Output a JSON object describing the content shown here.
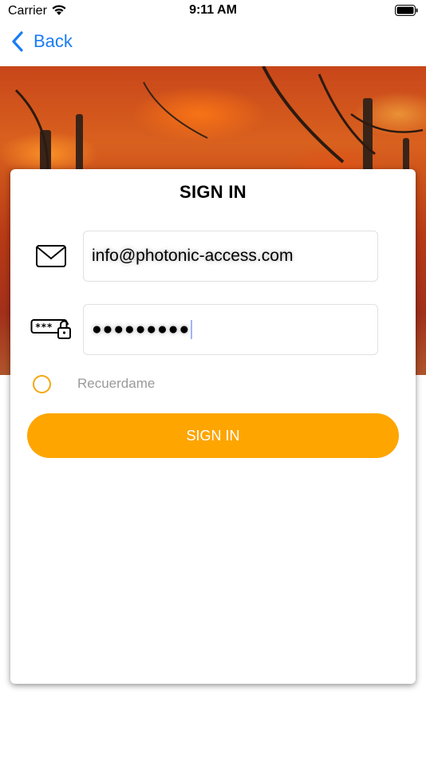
{
  "status_bar": {
    "carrier": "Carrier",
    "time": "9:11 AM"
  },
  "nav": {
    "back_label": "Back"
  },
  "hero": {
    "description_icon": "autumn-forest-image"
  },
  "login": {
    "title": "SIGN IN",
    "email_value": "info@photonic-access.com",
    "password_value": "●●●●●●●●●",
    "remember_label": "Recuerdame",
    "submit_label": "SIGN IN"
  },
  "colors": {
    "accent": "#fea500",
    "radio_border": "#f4a70e",
    "link_blue": "#1a7cf5"
  }
}
